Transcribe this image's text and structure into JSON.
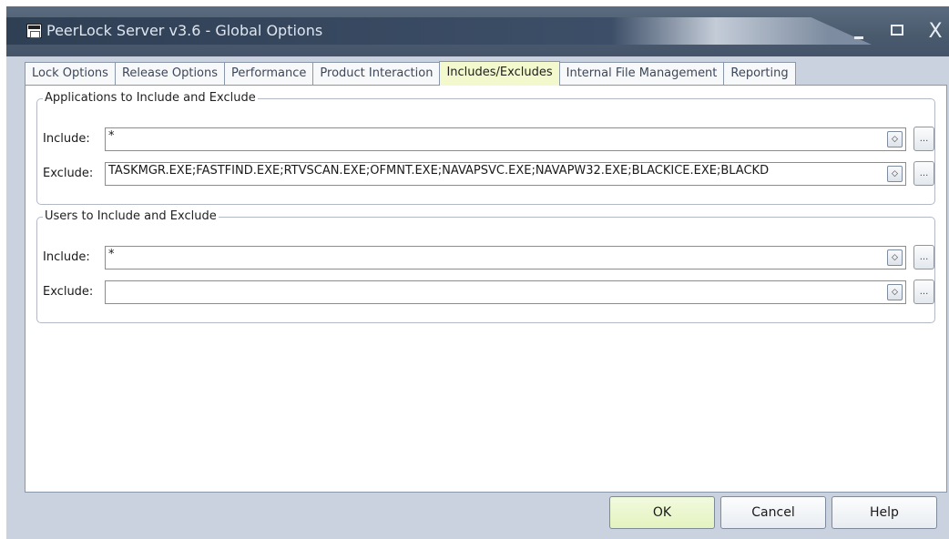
{
  "window": {
    "title": "PeerLock Server v3.6 - Global Options",
    "controls": {
      "minimize": "_",
      "maximize": "□",
      "close": "X"
    }
  },
  "tabs": [
    {
      "label": "Lock Options"
    },
    {
      "label": "Release Options"
    },
    {
      "label": "Performance"
    },
    {
      "label": "Product Interaction"
    },
    {
      "label": "Includes/Excludes",
      "active": true
    },
    {
      "label": "Internal File Management"
    },
    {
      "label": "Reporting"
    }
  ],
  "applications_group": {
    "title": "Applications to Include and Exclude",
    "include_label": "Include:",
    "include_value": "*",
    "exclude_label": "Exclude:",
    "exclude_value": "TASKMGR.EXE;FASTFIND.EXE;RTVSCAN.EXE;OFMNT.EXE;NAVAPSVC.EXE;NAVAPW32.EXE;BLACKICE.EXE;BLACKD"
  },
  "users_group": {
    "title": "Users to Include and Exclude",
    "include_label": "Include:",
    "include_value": "*",
    "exclude_label": "Exclude:",
    "exclude_value": ""
  },
  "field_controls": {
    "spin_glyph": "◇",
    "browse_glyph": "..."
  },
  "buttons": {
    "ok": "OK",
    "cancel": "Cancel",
    "help": "Help"
  },
  "colors": {
    "active_tab": "#f3f9cd",
    "titlebar": "#4a5a6d",
    "ok_button": "#e3f3bf"
  }
}
